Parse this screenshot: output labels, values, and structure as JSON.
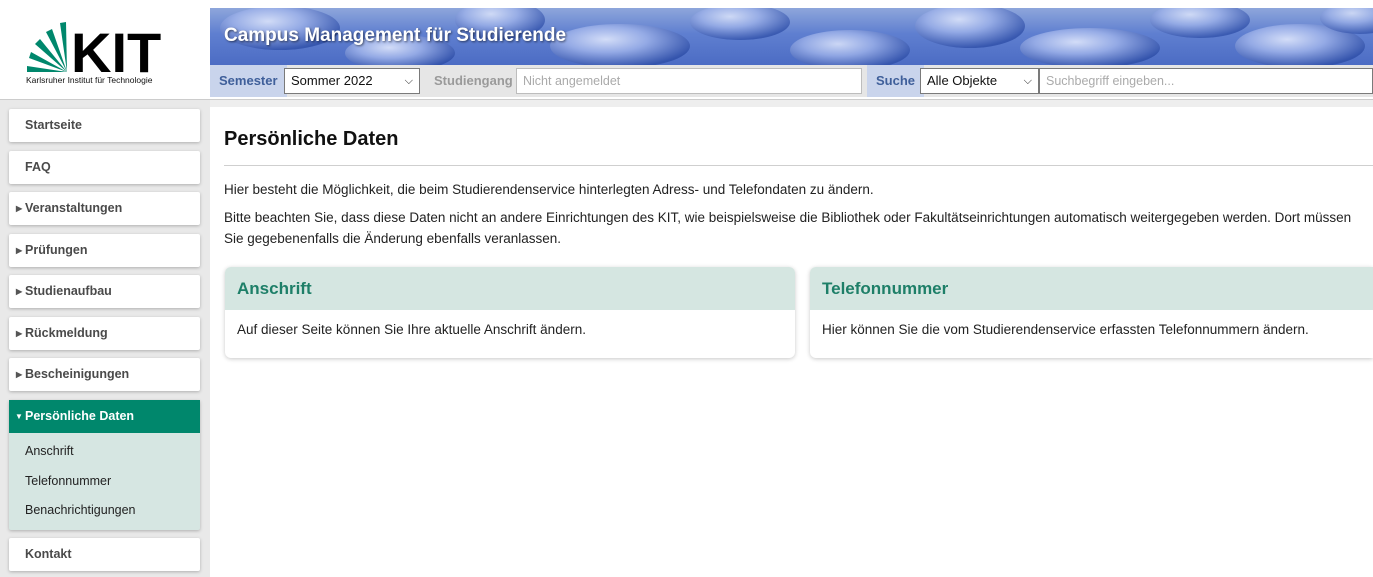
{
  "header": {
    "logo_text": "KIT",
    "logo_caption": "Karlsruher Institut für Technologie",
    "app_title": "Campus Management für Studierende"
  },
  "toolbar": {
    "semester_label": "Semester",
    "semester_value": "Sommer 2022",
    "studiengang_label": "Studiengang",
    "studiengang_placeholder": "Nicht angemeldet",
    "search_label": "Suche",
    "search_scope_value": "Alle Objekte",
    "search_placeholder": "Suchbegriff eingeben..."
  },
  "sidebar": {
    "items": [
      {
        "label": "Startseite",
        "expandable": false
      },
      {
        "label": "FAQ",
        "expandable": false
      },
      {
        "label": "Veranstaltungen",
        "expandable": true
      },
      {
        "label": "Prüfungen",
        "expandable": true
      },
      {
        "label": "Studienaufbau",
        "expandable": true
      },
      {
        "label": "Rückmeldung",
        "expandable": true
      },
      {
        "label": "Bescheinigungen",
        "expandable": true
      }
    ],
    "active": {
      "label": "Persönliche Daten",
      "subitems": [
        "Anschrift",
        "Telefonnummer",
        "Benachrichtigungen"
      ]
    },
    "contact": "Kontakt"
  },
  "main": {
    "title": "Persönliche Daten",
    "intro1": "Hier besteht die Möglichkeit, die beim Studierendenservice hinterlegten Adress- und Telefondaten zu ändern.",
    "intro2": "Bitte beachten Sie, dass diese Daten nicht an andere Einrichtungen des KIT, wie beispielsweise die Bibliothek oder Fakultätseinrichtungen automatisch weitergegeben werden. Dort müssen Sie gegebenenfalls die Änderung ebenfalls veranlassen.",
    "cards": [
      {
        "title": "Anschrift",
        "text": "Auf dieser Seite können Sie Ihre aktuelle Anschrift ändern."
      },
      {
        "title": "Telefonnummer",
        "text": "Hier können Sie die vom Studierendenservice erfassten Telefonnummern ändern."
      }
    ]
  },
  "colors": {
    "kit_green": "#00876c",
    "card_header": "#d5e6e1",
    "card_title": "#1e7f68",
    "toolbar_label": "#3f5f9a"
  },
  "icons": {
    "expand": "triangle-right-icon",
    "expanded": "triangle-down-icon",
    "select": "chevron-down-icon"
  }
}
